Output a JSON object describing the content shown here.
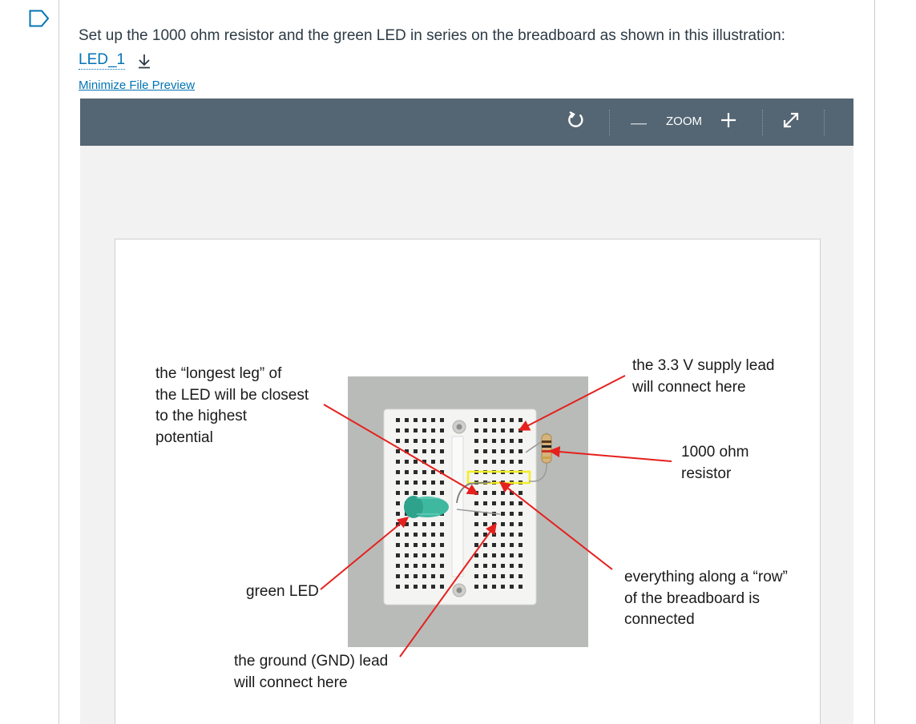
{
  "instruction": "Set up the 1000 ohm resistor and the green LED in series on the breadboard as shown in this illustration:",
  "file": {
    "name": "LED_1",
    "download_icon": "download-icon"
  },
  "preview_toggle": "Minimize File Preview",
  "toolbar": {
    "rotate_icon": "rotate-icon",
    "zoom_out_icon": "minus-icon",
    "zoom_label": "ZOOM",
    "zoom_in_icon": "plus-icon",
    "fullscreen_icon": "expand-icon"
  },
  "figure": {
    "annotations": {
      "longest_leg": [
        "the “longest leg” of",
        "the LED will be closest",
        "to the highest",
        "potential"
      ],
      "green_led": "green LED",
      "ground": [
        "the ground (GND) lead",
        "will connect here"
      ],
      "supply": [
        "the 3.3 V supply lead",
        "will connect here"
      ],
      "resistor": [
        "1000 ohm",
        "resistor"
      ],
      "row": [
        "everything along a “row”",
        "of the breadboard is",
        "connected"
      ]
    },
    "colors": {
      "arrow": "#e5201d",
      "highlight": "#f2ee25",
      "breadboard": "#f4f4f2",
      "led": "#3fb8a0"
    }
  }
}
